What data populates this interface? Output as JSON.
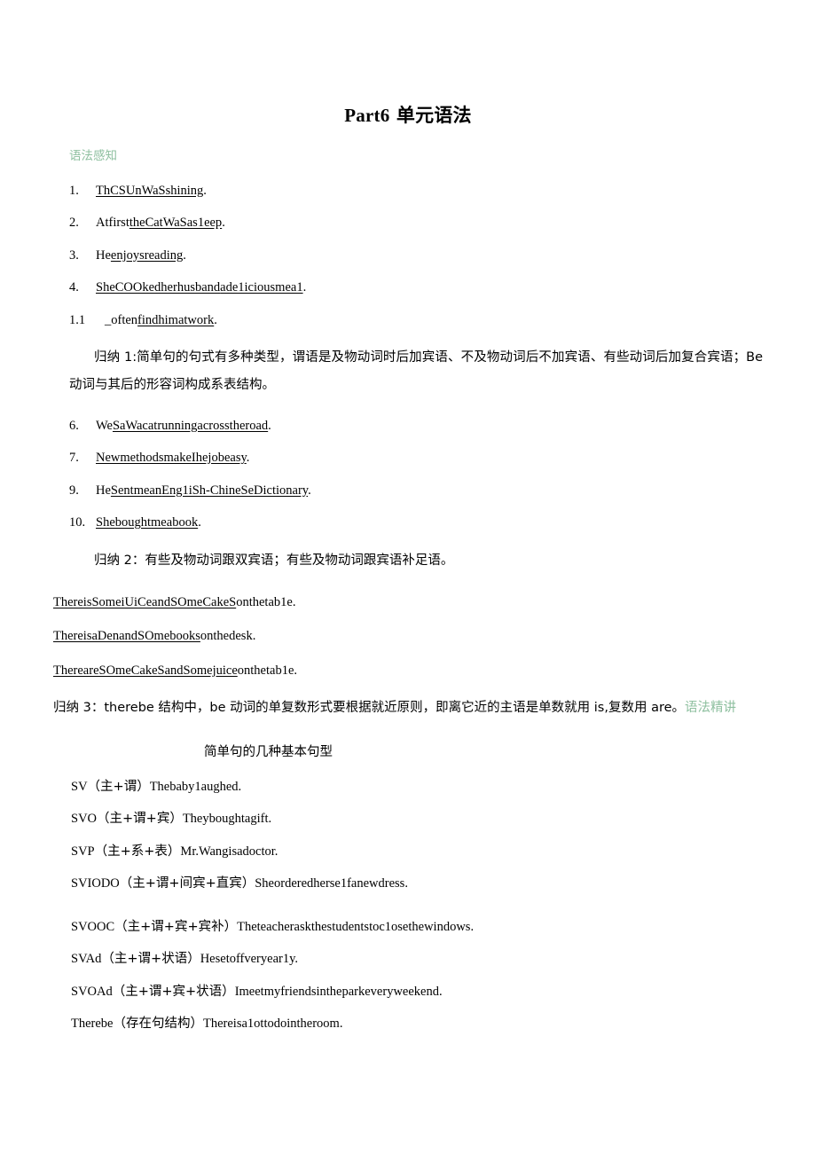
{
  "document": {
    "title": "Part6 单元语法",
    "title_bold_part": "Part6",
    "title_rest": " 单元语法"
  },
  "sections": {
    "perception_label": "语法感知",
    "lecture_label_line1": "语法",
    "lecture_label_line2": "精讲"
  },
  "exercises": [
    {
      "marker": "1.",
      "segments": [
        {
          "text": "ThCSUnWaSshining",
          "underline": true
        },
        {
          "text": ".",
          "underline": false
        }
      ]
    },
    {
      "marker": "2.",
      "segments": [
        {
          "text": "Atfirst",
          "underline": false
        },
        {
          "text": "theCatWaSas1eep",
          "underline": true
        },
        {
          "text": ".",
          "underline": false
        }
      ]
    },
    {
      "marker": "3.",
      "segments": [
        {
          "text": "He",
          "underline": false
        },
        {
          "text": "enjoysreading",
          "underline": true
        },
        {
          "text": ".",
          "underline": false
        }
      ]
    },
    {
      "marker": "4.",
      "segments": [
        {
          "text": "SheCOOkedherhusband",
          "underline": true
        },
        {
          "text": "ade1iciousmea1",
          "underline": true
        },
        {
          "text": ".",
          "underline": false
        }
      ]
    },
    {
      "marker": "1.1",
      "wide": true,
      "segments": [
        {
          "text": "_often",
          "underline": false
        },
        {
          "text": "findhimatwork",
          "underline": true
        },
        {
          "text": ".",
          "underline": false
        }
      ]
    }
  ],
  "summary_1": "归纳 1:简单句的句式有多种类型，谓语是及物动词时后加宾语、不及物动词后不加宾语、有些动词后加复合宾语；Be 动词与其后的形容词构成系表结构。",
  "exercises_2": [
    {
      "marker": "6.",
      "segments": [
        {
          "text": "We",
          "underline": false
        },
        {
          "text": "SaWacatrunningacrosstheroad",
          "underline": true
        },
        {
          "text": ".",
          "underline": false
        }
      ]
    },
    {
      "marker": "7.",
      "segments": [
        {
          "text": "NewmethodsmakeIhejobeasy",
          "underline": true
        },
        {
          "text": ".",
          "underline": false
        }
      ]
    },
    {
      "marker": "9.",
      "segments": [
        {
          "text": "He",
          "underline": false
        },
        {
          "text": "Sentmean",
          "underline": true
        },
        {
          "text": "Eng1iSh-ChineSeDictionary",
          "underline": true
        },
        {
          "text": ".",
          "underline": false
        }
      ]
    },
    {
      "marker": "10.",
      "segments": [
        {
          "text": "Shebought",
          "underline": true
        },
        {
          "text": "mea",
          "underline": true
        },
        {
          "text": "book",
          "underline": true
        },
        {
          "text": ".",
          "underline": false
        }
      ]
    }
  ],
  "summary_2": "归纳 2：有些及物动词跟双宾语；有些及物动词跟宾语补足语。",
  "there_be_lines": [
    {
      "segments": [
        {
          "text": "Thereis",
          "underline": true
        },
        {
          "text": "SomeiUiCeandSOmeCakeS",
          "underline": true
        },
        {
          "text": "onthetab1e.",
          "underline": false
        }
      ]
    },
    {
      "segments": [
        {
          "text": "ThereisaDenandSOmebooks",
          "underline": true
        },
        {
          "text": "onthedesk.",
          "underline": false
        }
      ]
    },
    {
      "segments": [
        {
          "text": "ThereareSOmeCakeSandSomejuice",
          "underline": true
        },
        {
          "text": "onthetab1e.",
          "underline": false
        }
      ]
    }
  ],
  "summary_3_prefix": "归纳 3：therebe 结构中，be 动词的单复数形式要根据就近原则，即离它近的主语是单数就用 is,复数用 are。",
  "pattern_heading": "简单句的几种基本句型",
  "patterns": [
    {
      "code": "SV",
      "structure": "（主+谓）",
      "example": "Thebaby1aughed."
    },
    {
      "code": "SVO",
      "structure": "（主+谓+宾）",
      "example": "Theyboughtagift."
    },
    {
      "code": "SVP",
      "structure": "（主+系+表）",
      "example": "Mr.Wangisadoctor."
    },
    {
      "code": "SVIODO",
      "structure": "（主+谓+间宾+直宾）",
      "example": "Sheorderedherse1fanewdress."
    },
    {
      "code": "SVOOC",
      "structure": "（主+谓+宾+宾补）",
      "example": "Theteacheraskthestudentstoc1osethewindows.",
      "gap": true
    },
    {
      "code": "SVAd",
      "structure": "（主+谓+状语）",
      "example": "Hesetoffveryear1y."
    },
    {
      "code": "SVOAd",
      "structure": "（主+谓+宾+状语）",
      "example": "Imeetmyfriendsintheparkeveryweekend."
    },
    {
      "code": "Therebe",
      "structure": "（存在句结构）",
      "example": "Thereisa1ottodointheroom."
    }
  ],
  "colors": {
    "green_accent": "#8FC0A0",
    "text": "#000000",
    "background": "#FFFFFF"
  }
}
